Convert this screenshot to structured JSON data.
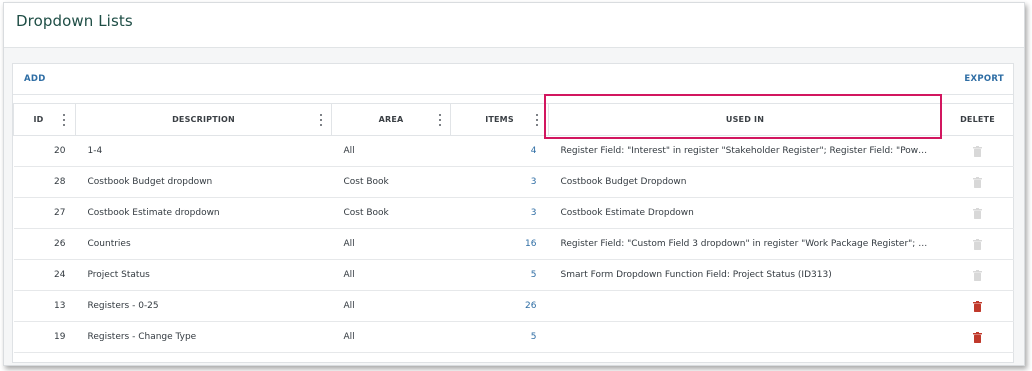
{
  "page": {
    "title": "Dropdown Lists"
  },
  "toolbar": {
    "add_label": "ADD",
    "export_label": "EXPORT"
  },
  "columns": {
    "id": "ID",
    "description": "DESCRIPTION",
    "area": "AREA",
    "items": "ITEMS",
    "used_in": "USED IN",
    "delete": "DELETE"
  },
  "rows": [
    {
      "id": "20",
      "description": "1-4",
      "area": "All",
      "items": "4",
      "used_in": "Register Field: \"Interest\" in register \"Stakeholder Register\"; Register Field: \"Power\" in re...",
      "delete_enabled": false
    },
    {
      "id": "28",
      "description": "Costbook Budget dropdown",
      "area": "Cost Book",
      "items": "3",
      "used_in": "Costbook Budget Dropdown",
      "delete_enabled": false
    },
    {
      "id": "27",
      "description": "Costbook Estimate dropdown",
      "area": "Cost Book",
      "items": "3",
      "used_in": "Costbook Estimate Dropdown",
      "delete_enabled": false
    },
    {
      "id": "26",
      "description": "Countries",
      "area": "All",
      "items": "16",
      "used_in": "Register Field: \"Custom Field 3 dropdown\" in register \"Work Package Register\"; Smart F...",
      "delete_enabled": false
    },
    {
      "id": "24",
      "description": "Project Status",
      "area": "All",
      "items": "5",
      "used_in": "Smart Form Dropdown Function Field: Project Status (ID313)",
      "delete_enabled": false
    },
    {
      "id": "13",
      "description": "Registers - 0-25",
      "area": "All",
      "items": "26",
      "used_in": "",
      "delete_enabled": true
    },
    {
      "id": "19",
      "description": "Registers - Change Type",
      "area": "All",
      "items": "5",
      "used_in": "",
      "delete_enabled": true
    }
  ],
  "icons": {
    "menu": "kebab-menu-icon",
    "delete": "trash-icon"
  },
  "colors": {
    "title": "#1f4e46",
    "link": "#2e6da4",
    "highlight": "#d2165f",
    "delete_active": "#c0392b",
    "delete_disabled": "#d8d8d8"
  }
}
